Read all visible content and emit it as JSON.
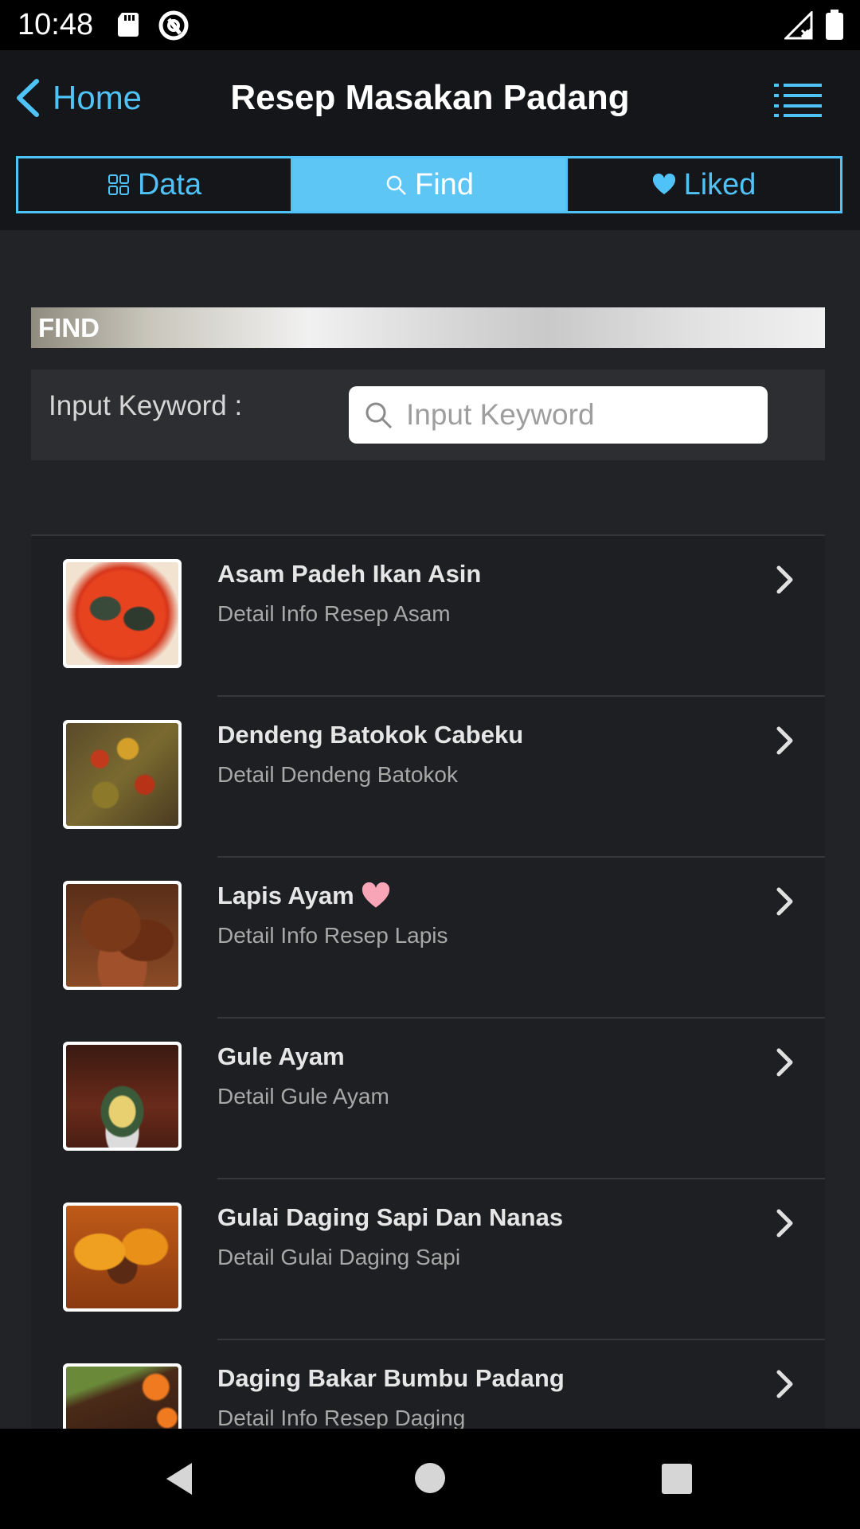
{
  "status_bar": {
    "time": "10:48"
  },
  "header": {
    "back_label": "Home",
    "title": "Resep Masakan Padang"
  },
  "tabs": [
    {
      "label": "Data",
      "icon": "grid-icon",
      "active": false
    },
    {
      "label": "Find",
      "icon": "search-icon",
      "active": true
    },
    {
      "label": "Liked",
      "icon": "heart-icon",
      "active": false
    }
  ],
  "find": {
    "section_title": "FIND",
    "keyword_label": "Input Keyword :",
    "search_placeholder": "Input Keyword",
    "search_value": ""
  },
  "recipes": [
    {
      "name": "Asam Padeh Ikan Asin",
      "detail": "Detail Info Resep Asam",
      "liked": false
    },
    {
      "name": "Dendeng Batokok Cabeku",
      "detail": "Detail Dendeng Batokok",
      "liked": false
    },
    {
      "name": "Lapis Ayam",
      "detail": "Detail Info Resep Lapis",
      "liked": true
    },
    {
      "name": "Gule Ayam",
      "detail": "Detail Gule Ayam",
      "liked": false
    },
    {
      "name": "Gulai Daging Sapi Dan Nanas",
      "detail": "Detail Gulai Daging Sapi",
      "liked": false
    },
    {
      "name": "Daging Bakar Bumbu Padang",
      "detail": "Detail Info Resep Daging",
      "liked": false
    }
  ],
  "colors": {
    "accent": "#4fc3f7",
    "active_tab": "#5ec6f5",
    "heart": "#f8a5b8"
  }
}
